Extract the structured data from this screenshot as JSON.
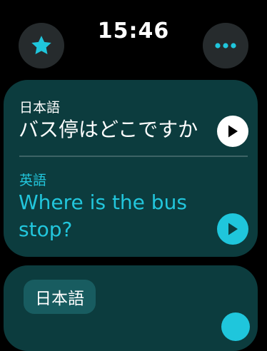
{
  "status": {
    "time": "15:46"
  },
  "toolbar": {
    "favorite_icon": "star-icon",
    "more_icon": "ellipsis-icon",
    "accent_color": "#1fc6dc"
  },
  "translation": {
    "source_language": "日本語",
    "source_text": "バス停はどこですか",
    "target_language": "英語",
    "target_text": "Where is the bus stop?",
    "play_icon": "play-icon"
  },
  "next_card": {
    "language": "日本語"
  }
}
